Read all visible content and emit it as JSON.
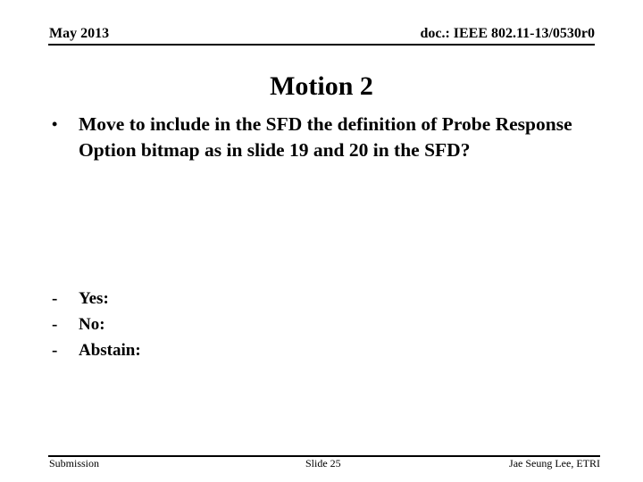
{
  "header": {
    "date": "May 2013",
    "doc_id": "doc.: IEEE 802.11-13/0530r0"
  },
  "slide": {
    "title": "Motion 2",
    "bullets": [
      {
        "marker": "•",
        "text": "Move to include in the SFD the definition of Probe Response Option bitmap as in slide 19 and 20 in the SFD?"
      }
    ],
    "vote_options": [
      {
        "marker": "-",
        "label": "Yes:"
      },
      {
        "marker": "-",
        "label": "No:"
      },
      {
        "marker": "-",
        "label": "Abstain:"
      }
    ]
  },
  "footer": {
    "left": "Submission",
    "center": "Slide 25",
    "right": "Jae Seung Lee, ETRI"
  }
}
